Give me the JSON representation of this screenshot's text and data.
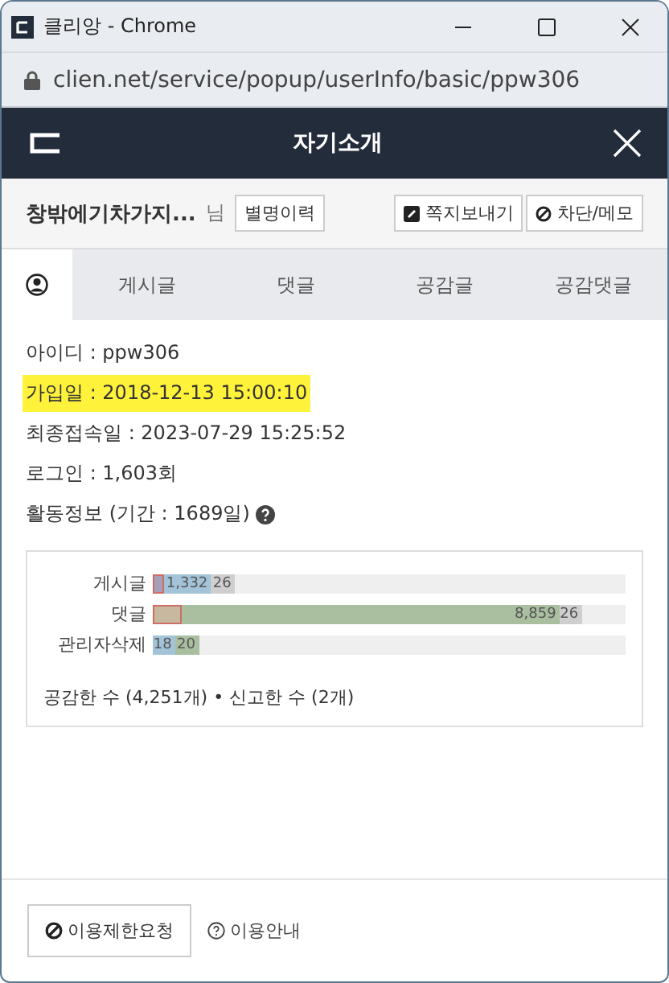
{
  "browser": {
    "title": "클리앙 - Chrome",
    "url": "clien.net/service/popup/userInfo/basic/ppw306"
  },
  "header": {
    "title": "자기소개"
  },
  "user": {
    "nickname": "창밖에기차가지...",
    "suffix": "님",
    "history_button": "별명이력",
    "actions": [
      "쪽지보내기",
      "차단/메모"
    ]
  },
  "tabs": [
    {
      "kind": "icon",
      "selected": true
    },
    {
      "kind": "text",
      "label": "게시글",
      "selected": false
    },
    {
      "kind": "text",
      "label": "댓글",
      "selected": false
    },
    {
      "kind": "text",
      "label": "공감글",
      "selected": false
    },
    {
      "kind": "text",
      "label": "공감댓글",
      "selected": false
    }
  ],
  "info": [
    {
      "text": "아이디 : ppw306",
      "highlighted": false,
      "help": false
    },
    {
      "text": "가입일 : 2018-12-13 15:00:10",
      "highlighted": true,
      "help": false
    },
    {
      "text": "최종접속일 : 2023-07-29 15:25:52",
      "highlighted": false,
      "help": false
    },
    {
      "text": "로그인 : 1,603회",
      "highlighted": false,
      "help": false
    },
    {
      "text": "활동정보 (기간 : 1689일)",
      "highlighted": false,
      "help": true
    }
  ],
  "activity": {
    "rows": [
      {
        "label": "게시글",
        "segments": [
          {
            "kind": "marker",
            "color": "#a7a0b8"
          },
          {
            "kind": "count",
            "color": "#a3c3d8",
            "text": "1,332"
          },
          {
            "kind": "count",
            "color": "#cfcfcf",
            "text": "26"
          }
        ]
      },
      {
        "label": "댓글",
        "segments": [
          {
            "kind": "marker",
            "color": "#c8b8a0"
          },
          {
            "kind": "count",
            "color": "#a9bfa0",
            "text": "8,859"
          },
          {
            "kind": "count",
            "color": "#cfcfcf",
            "text": "26"
          }
        ]
      },
      {
        "label": "관리자삭제",
        "segments": [
          {
            "kind": "count",
            "color": "#a3c3d8",
            "text": "18"
          },
          {
            "kind": "count",
            "color": "#a9bfa0",
            "text": "20"
          }
        ]
      }
    ],
    "summary": "공감한 수 (4,251개) • 신고한 수 (2개)"
  },
  "footer": {
    "restrict_button": "이용제한요청",
    "guide_link": "이용안내"
  }
}
